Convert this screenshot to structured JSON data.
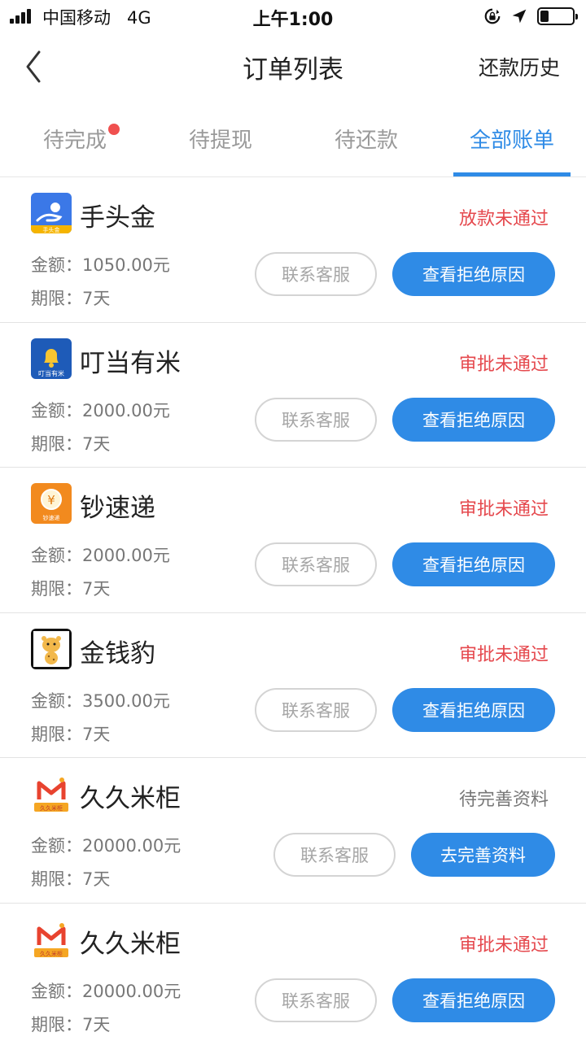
{
  "status_bar": {
    "carrier": "中国移动",
    "network": "4G",
    "time": "上午1:00",
    "battery_level": 0.25
  },
  "nav": {
    "title": "订单列表",
    "right_action": "还款历史"
  },
  "tabs": [
    {
      "label": "待完成",
      "badge": true
    },
    {
      "label": "待提现",
      "badge": false
    },
    {
      "label": "待还款",
      "badge": false
    },
    {
      "label": "全部账单",
      "active": true
    }
  ],
  "colors": {
    "accent": "#2f8be6",
    "rejected": "#e5484d",
    "pending": "#777777",
    "badge": "#f0504f"
  },
  "orders": [
    {
      "app": "手头金",
      "logo": "shoutoujin-logo",
      "logo_text": "手头金",
      "status": "放款未通过",
      "status_type": "rejected",
      "amount": "金额：1050.00元",
      "term": "期限：7天",
      "secondary_btn": "联系客服",
      "primary_btn": "查看拒绝原因"
    },
    {
      "app": "叮当有米",
      "logo": "bell-logo",
      "logo_text": "叮当有米",
      "status": "审批未通过",
      "status_type": "rejected",
      "amount": "金额：2000.00元",
      "term": "期限：7天",
      "secondary_btn": "联系客服",
      "primary_btn": "查看拒绝原因"
    },
    {
      "app": "钞速递",
      "logo": "yen-coin-logo",
      "logo_text": "钞速递",
      "status": "审批未通过",
      "status_type": "rejected",
      "amount": "金额：2000.00元",
      "term": "期限：7天",
      "secondary_btn": "联系客服",
      "primary_btn": "查看拒绝原因"
    },
    {
      "app": "金钱豹",
      "logo": "leopard-logo",
      "status": "审批未通过",
      "status_type": "rejected",
      "amount": "金额：3500.00元",
      "term": "期限：7天",
      "secondary_btn": "联系客服",
      "primary_btn": "查看拒绝原因"
    },
    {
      "app": "久久米柜",
      "logo": "m-logo",
      "logo_text": "久久米柜",
      "status": "待完善资料",
      "status_type": "pending",
      "amount": "金额：20000.00元",
      "term": "期限：7天",
      "secondary_btn": "联系客服",
      "primary_btn": "去完善资料"
    },
    {
      "app": "久久米柜",
      "logo": "m-logo",
      "logo_text": "久久米柜",
      "status": "审批未通过",
      "status_type": "rejected",
      "amount": "金额：20000.00元",
      "term": "期限：7天",
      "secondary_btn": "联系客服",
      "primary_btn": "查看拒绝原因"
    }
  ]
}
